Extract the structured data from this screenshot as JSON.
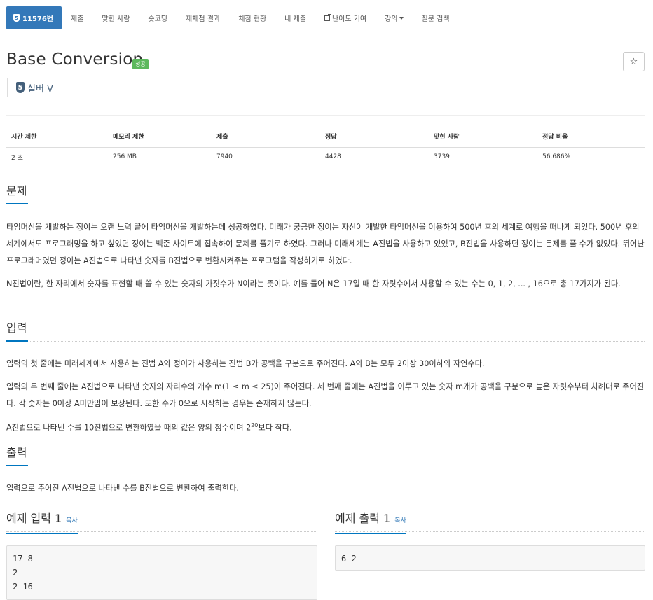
{
  "nav": {
    "problem_number": "11576번",
    "problem_badge": "5",
    "tabs": [
      "제출",
      "맞힌 사람",
      "숏코딩",
      "재채점 결과",
      "채점 현황",
      "내 제출",
      "난이도 기여",
      "강의",
      "질문 검색"
    ]
  },
  "title": "Base Conversion",
  "status_badge": "성공",
  "star": "☆",
  "tier": {
    "level": "5",
    "label": "실버 V"
  },
  "info": {
    "headers": [
      "시간 제한",
      "메모리 제한",
      "제출",
      "정답",
      "맞힌 사람",
      "정답 비율"
    ],
    "values": [
      "2 초",
      "256 MB",
      "7940",
      "4428",
      "3739",
      "56.686%"
    ]
  },
  "sections": {
    "problem": {
      "heading": "문제",
      "p1": "타임머신을 개발하는 정이는 오랜 노력 끝에 타임머신을 개발하는데 성공하였다. 미래가 궁금한 정이는 자신이 개발한 타임머신을 이용하여 500년 후의 세계로 여행을 떠나게 되었다. 500년 후의 세계에서도 프로그래밍을 하고 싶었던 정이는 백준 사이트에 접속하여 문제를 풀기로 하였다. 그러나 미래세계는 A진법을 사용하고 있었고, B진법을 사용하던 정이는 문제를 풀 수가 없었다. 뛰어난 프로그래머였던 정이는 A진법으로 나타낸 숫자를 B진법으로 변환시켜주는 프로그램을 작성하기로 하였다.",
      "p2": "N진법이란, 한 자리에서 숫자를 표현할 때 쓸 수 있는 숫자의 가짓수가 N이라는 뜻이다. 예를 들어 N은 17일 때 한 자릿수에서 사용할 수 있는 수는 0, 1, 2, ... , 16으로 총 17가지가 된다."
    },
    "input": {
      "heading": "입력",
      "p1": "입력의 첫 줄에는 미래세계에서 사용하는 진법 A와 정이가 사용하는 진법 B가 공백을 구분으로 주어진다. A와 B는 모두 2이상 30이하의 자연수다.",
      "p2": "입력의 두 번째 줄에는 A진법으로 나타낸 숫자의 자리수의 개수 m(1 ≤ m ≤ 25)이 주어진다. 세 번째 줄에는 A진법을 이루고 있는 숫자 m개가 공백을 구분으로 높은 자릿수부터 차례대로 주어진다. 각 숫자는 0이상 A미만임이 보장된다. 또한 수가 0으로 시작하는 경우는 존재하지 않는다.",
      "p3_before": "A진법으로 나타낸 수를 10진법으로 변환하였을 때의 값은 양의 정수이며 2",
      "p3_sup": "20",
      "p3_after": "보다 작다."
    },
    "output": {
      "heading": "출력",
      "p1": "입력으로 주어진 A진법으로 나타낸 수를 B진법으로 변환하여 출력한다."
    }
  },
  "examples": {
    "input_label": "예제 입력 1",
    "output_label": "예제 출력 1",
    "copy": "복사",
    "input_text": "17 8\n2\n2 16",
    "output_text": "6 2"
  }
}
